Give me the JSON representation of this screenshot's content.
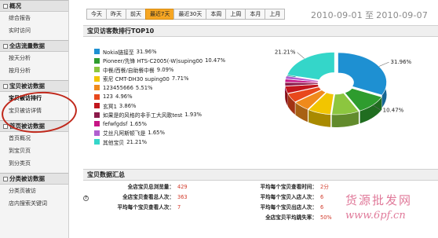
{
  "sidebar": {
    "sections": [
      {
        "title": "概况",
        "items": [
          {
            "label": "综合报告"
          },
          {
            "label": "实时访问"
          }
        ]
      },
      {
        "title": "全店流量数据",
        "items": [
          {
            "label": "按天分析"
          },
          {
            "label": "按月分析"
          }
        ]
      },
      {
        "title": "宝贝被访数据",
        "items": [
          {
            "label": "宝贝被访排行"
          },
          {
            "label": "宝贝被访详情"
          }
        ]
      },
      {
        "title": "首页被访数据",
        "items": [
          {
            "label": "首页概况"
          },
          {
            "label": "到宝贝页"
          },
          {
            "label": "到分类页"
          }
        ]
      },
      {
        "title": "分类被访数据",
        "items": [
          {
            "label": "分类页被访"
          },
          {
            "label": "店内搜索关键词"
          }
        ]
      }
    ]
  },
  "datebar": {
    "buttons": [
      "今天",
      "昨天",
      "前天",
      "最近7天",
      "最近30天",
      "本周",
      "上周",
      "本月",
      "上月"
    ],
    "selected": "最近7天"
  },
  "daterange": {
    "start": "2010-09-01",
    "sep": "至",
    "end": "2010-09-07"
  },
  "chart_panel": {
    "title": "宝贝访客数排行TOP10"
  },
  "chart_data": {
    "type": "pie",
    "style": "3d exploded donut",
    "legend_position": "left",
    "slices": [
      {
        "label": "Nokia链接至",
        "value": 31.96,
        "pct_text": "31.96%",
        "color": "#1e90d2"
      },
      {
        "label": "Pioneer/先锋 HTS-C2005(-W)suping00",
        "value": 10.47,
        "pct_text": "10.47%",
        "color": "#2e9c2e"
      },
      {
        "label": "中餐/西餐/自助餐中餐",
        "value": 9.09,
        "pct_text": "9.09%",
        "color": "#8cc63f"
      },
      {
        "label": "索尼 CMT-DH30 suping00",
        "value": 7.71,
        "pct_text": "7.71%",
        "color": "#f2c500"
      },
      {
        "label": "123455666",
        "value": 5.51,
        "pct_text": "5.51%",
        "color": "#f08a1c"
      },
      {
        "label": "123",
        "value": 4.96,
        "pct_text": "4.96%",
        "color": "#e8481c"
      },
      {
        "label": "玄冥1",
        "value": 3.86,
        "pct_text": "3.86%",
        "color": "#c2161d"
      },
      {
        "label": "如果是的风格的非手工大风歌test",
        "value": 1.93,
        "pct_text": "1.93%",
        "color": "#8b1a4a"
      },
      {
        "label": "fefwfgdsf",
        "value": 1.65,
        "pct_text": "1.65%",
        "color": "#c71585"
      },
      {
        "label": "艾丝凡阿斯顿飞是",
        "value": 1.65,
        "pct_text": "1.65%",
        "color": "#b05fd0"
      },
      {
        "label": "其他宝贝",
        "value": 21.21,
        "pct_text": "21.21%",
        "color": "#34d6c9"
      }
    ],
    "callouts": [
      "31.96%",
      "10.47%",
      "21.21%"
    ]
  },
  "summary_panel": {
    "title": "宝贝数据汇总",
    "left": [
      {
        "label": "全店宝贝总浏览量：",
        "value": "429"
      },
      {
        "label": "全店宝贝查看总人次：",
        "value": "363"
      },
      {
        "label": "平均每个宝贝查看人次：",
        "value": "7"
      }
    ],
    "right": [
      {
        "label": "平均每个宝贝查看时间：",
        "value": "2分"
      },
      {
        "label": "平均每个宝贝入店人次：",
        "value": "6"
      },
      {
        "label": "平均每个宝贝出店人次：",
        "value": "6"
      },
      {
        "label": "全店宝贝平均跳失率：",
        "value": "50%"
      }
    ],
    "help_icon_text": "?"
  },
  "watermark": {
    "cn": "货源批发网",
    "url": "www.6pf.cn"
  },
  "colors": {
    "accent_selected": "#f6a623",
    "value_red": "#d23a2a",
    "highlight_circle": "#c0281b",
    "watermark": "#e07a9a"
  }
}
